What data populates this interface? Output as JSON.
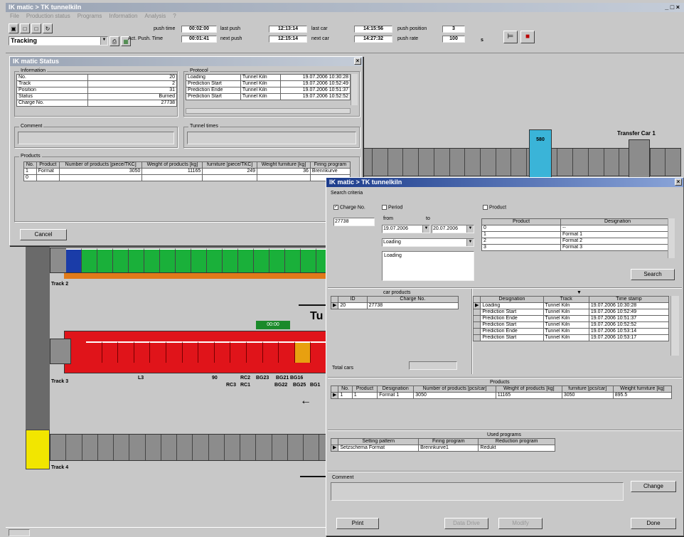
{
  "app": {
    "title": "IK matic > TK tunnelkiln",
    "menu": [
      "File",
      "Production status",
      "Programs",
      "Information",
      "Analysis",
      "?"
    ],
    "window_controls": "_ □ ×"
  },
  "toolbar": {
    "mode_value": "Tracking",
    "push_time_label": "push time",
    "push_time": "00:02:00",
    "last_push_label": "last push",
    "last_push": "12:13:14",
    "act_push_time_label": "Act. Push. Time",
    "act_push_time": "00:01:41",
    "next_push_label": "next push",
    "next_push": "12:15:14",
    "last_car_label": "last car",
    "last_car": "14:15:56",
    "next_car_label": "next car",
    "next_car": "14:27:32",
    "push_position_label": "push position",
    "push_position": "3",
    "push_rate_label": "push rate",
    "push_rate": "100",
    "unit": "s"
  },
  "info_window": {
    "title": "IK matic Status",
    "info_label": "Information",
    "info_rows": [
      {
        "k": "No.",
        "v": "20"
      },
      {
        "k": "Track",
        "v": "2"
      },
      {
        "k": "Position",
        "v": "31"
      },
      {
        "k": "Status",
        "v": "Burned"
      },
      {
        "k": "Charge No.",
        "v": "27738"
      }
    ],
    "protocol_label": "Protocol",
    "protocol_rows": [
      [
        "Loading",
        "Tunnel Kiln",
        "19.07.2006 10:30:28"
      ],
      [
        "Prediction Start",
        "Tunnel Kiln",
        "19.07.2006 10:52:49"
      ],
      [
        "Prediction Ende",
        "Tunnel Kiln",
        "19.07.2006 10:51:37"
      ],
      [
        "Prediction Start",
        "Tunnel Kiln",
        "19.07.2006 10:52:52"
      ]
    ],
    "comment_label": "Comment",
    "tunnel_times_label": "Tunnel times",
    "products_label": "Products",
    "products_headers": [
      "No.",
      "Product",
      "Number of products [piece/TKC]",
      "Weight of products [kg]",
      "furniture [piece/TKC]",
      "Weight furniture [kg]",
      "Firing program"
    ],
    "products_rows": [
      [
        "1",
        "Format",
        "3050",
        "11165",
        "249",
        "36",
        "Brennkurve"
      ],
      [
        "0",
        "",
        "",
        "",
        "",
        "",
        ""
      ]
    ],
    "cancel_label": "Cancel"
  },
  "tracks": {
    "track2_label": "Track 2",
    "track3_label": "Track 3",
    "track4_label": "Track 4",
    "transfer_car_label": "Transfer Car 1",
    "transfer_car_no": "580",
    "tunnel_label": "Tu",
    "green_box": "00:00",
    "track3_markers": [
      "L3",
      "90",
      "RC2",
      "BG23",
      "BG21",
      "BG16",
      "RC3",
      "RC1",
      "BG22",
      "BG25",
      "BG1"
    ]
  },
  "search_window": {
    "title": "IK matic > TK tunnelkiln",
    "search_criteria_label": "Search criteria",
    "charge_no_label": "Charge No.",
    "charge_no_value": "27738",
    "period_label": "Period",
    "from_label": "from",
    "to_label": "to",
    "from_value": "19.07.2006",
    "to_value": "20.07.2006",
    "event_value": "Loading",
    "event_list": [
      "Loading"
    ],
    "product_label": "Product",
    "product_headers": [
      "Product",
      "Designation"
    ],
    "product_rows": [
      [
        "0",
        "--"
      ],
      [
        "1",
        "Format 1"
      ],
      [
        "2",
        "Format 2"
      ],
      [
        "3",
        "Format 3"
      ]
    ],
    "search_button": "Search",
    "car_products_label": "car products",
    "car_headers": [
      "ID",
      "Charge No."
    ],
    "car_rows": [
      [
        "20",
        "27738"
      ]
    ],
    "total_cars_label": "Total cars",
    "protocol_headers": [
      "Designation",
      "Track",
      "Time stamp"
    ],
    "protocol_rows": [
      [
        "Loading",
        "Tunnel Kiln",
        "19.07.2006 10:30:28"
      ],
      [
        "Prediction Start",
        "Tunnel Kiln",
        "19.07.2006 10:52:49"
      ],
      [
        "Prediction Ende",
        "Tunnel Kiln",
        "19.07.2006 10:51:37"
      ],
      [
        "Prediction Start",
        "Tunnel Kiln",
        "19.07.2006 10:52:52"
      ],
      [
        "Prediction Ende",
        "Tunnel Kiln",
        "19.07.2006 10:53:14"
      ],
      [
        "Prediction Start",
        "Tunnel Kiln",
        "19.07.2006 10:53:17"
      ]
    ],
    "products_label": "Products",
    "products_headers": [
      "No.",
      "Product",
      "Designation",
      "Number of products [pcs/car]",
      "Weight of products [kg]",
      "furniture [pcs/car]",
      "Weight furniture [kg]"
    ],
    "products_rows": [
      [
        "1",
        "1",
        "Format 1",
        "3050",
        "11165",
        "3050",
        "895.5"
      ]
    ],
    "used_programs_label": "Used programs",
    "programs_headers": [
      "Setting pattern",
      "Firing program",
      "Reduction program"
    ],
    "programs_rows": [
      [
        "Setzschema Format",
        "Brennkurve1",
        "Redukt"
      ]
    ],
    "comment_label": "Comment",
    "change_button": "Change",
    "print_button": "Print",
    "btn2": "Data Drive",
    "btn3": "Modify",
    "done_button": "Done"
  }
}
